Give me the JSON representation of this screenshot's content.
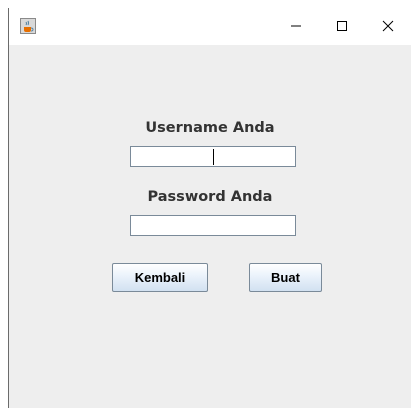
{
  "titlebar": {
    "app_icon": "java-coffee-cup-icon",
    "minimize_icon": "minimize-icon",
    "maximize_icon": "maximize-icon",
    "close_icon": "close-icon"
  },
  "form": {
    "username_label": "Username Anda",
    "username_value": "",
    "password_label": "Password Anda",
    "password_value": ""
  },
  "buttons": {
    "back_label": "Kembali",
    "create_label": "Buat"
  },
  "colors": {
    "window_background": "#eeeeee",
    "titlebar_background": "#ffffff",
    "label_text": "#333333",
    "field_border": "#7a8a99"
  }
}
